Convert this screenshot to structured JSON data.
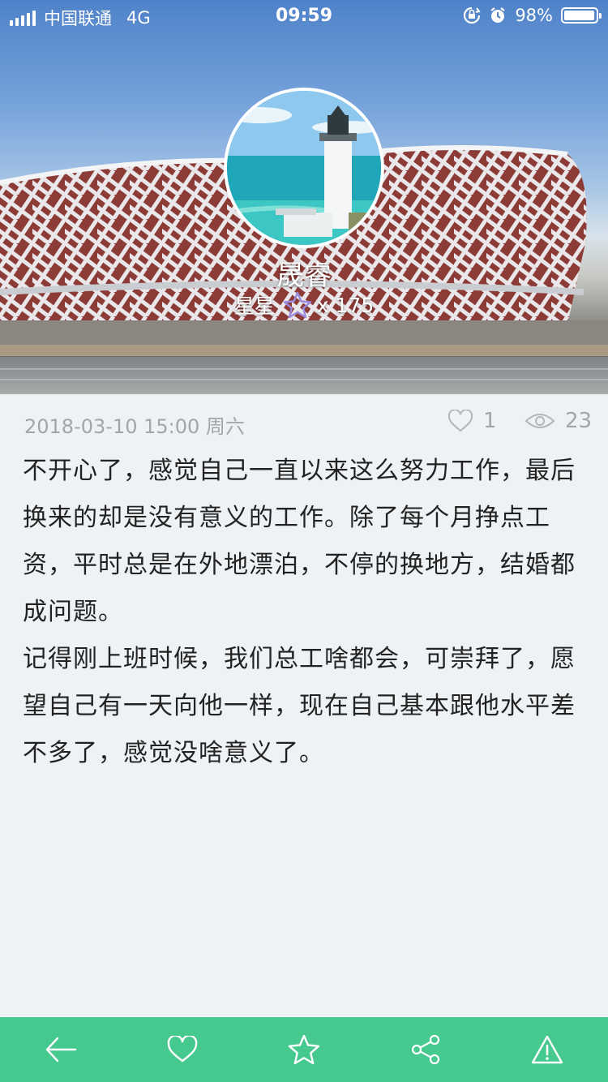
{
  "status_bar": {
    "carrier": "中国联通",
    "network": "4G",
    "time": "09:59",
    "battery": "98%",
    "battery_level": 0.98
  },
  "profile": {
    "name": "晟睿",
    "stars_label": "星星",
    "stars_count": "x 175"
  },
  "post": {
    "date": "2018-03-10 15:00 周六",
    "likes": "1",
    "views": "23",
    "paragraphs": [
      "不开心了，感觉自己一直以来这么努力工作，最后换来的却是没有意义的工作。除了每个月挣点工资，平时总是在外地漂泊，不停的换地方，结婚都成问题。",
      "记得刚上班时候，我们总工啥都会，可崇拜了，愿望自己有一天向他一样，现在自己基本跟他水平差不多了，感觉没啥意义了。"
    ]
  },
  "bottom_bar": {
    "items": [
      "back-icon",
      "heart-icon",
      "star-icon",
      "share-icon",
      "report-warning-icon"
    ],
    "color": "#45c98e"
  }
}
